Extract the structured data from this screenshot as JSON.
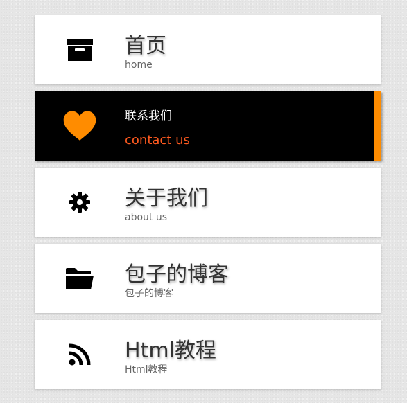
{
  "menu": {
    "items": [
      {
        "icon": "archive-icon",
        "title": "首页",
        "subtitle": "home"
      },
      {
        "icon": "heart-icon",
        "title": "联系我们",
        "subtitle": "contact us",
        "active": true
      },
      {
        "icon": "gear-icon",
        "title": "关于我们",
        "subtitle": "about us"
      },
      {
        "icon": "folder-open-icon",
        "title": "包子的博客",
        "subtitle": "包子的博客"
      },
      {
        "icon": "rss-icon",
        "title": "Html教程",
        "subtitle": "Html教程"
      }
    ]
  },
  "colors": {
    "accent": "#ff8c00",
    "active_background": "#000000",
    "active_subtitle": "#ff5a1f",
    "item_background": "#ffffff",
    "title_text": "#333333",
    "subtitle_text": "#666666"
  }
}
